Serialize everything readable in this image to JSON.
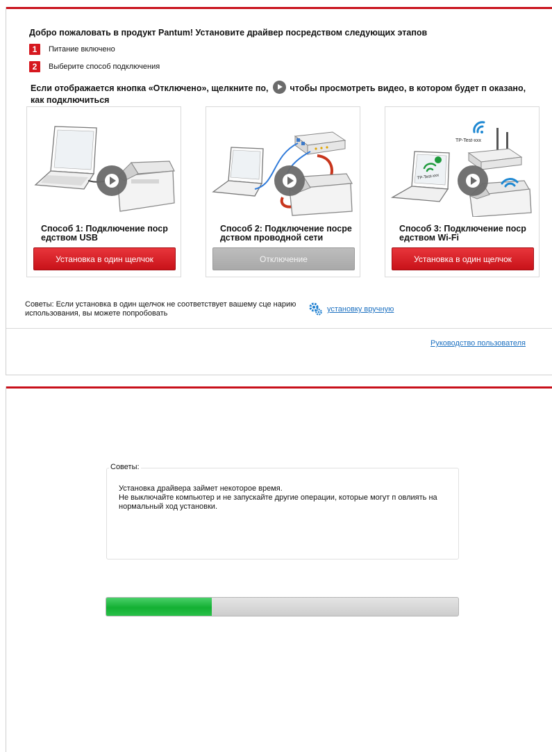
{
  "installer": {
    "welcome_title": "Добро пожаловать в продукт Pantum! Установите драйвер посредством следующих этапов",
    "steps": [
      {
        "number": "1",
        "label": "Питание включено"
      },
      {
        "number": "2",
        "label": "Выберите способ подключения"
      }
    ],
    "instruction_before": "Если отображается кнопка «Отключено», щелкните по,",
    "instruction_after": "чтобы просмотреть видео, в котором будет п оказано, как подключиться",
    "methods": [
      {
        "caption": "Способ 1: Подключение поср едством USB",
        "button": "Установка в один щелчок",
        "enabled": true
      },
      {
        "caption": "Способ 2: Подключение посре дством проводной сети",
        "button": "Отключение",
        "enabled": false
      },
      {
        "caption": "Способ 3: Подключение поср едством Wi-Fi",
        "button": "Установка в один щелчок",
        "enabled": true
      }
    ],
    "illustration_labels": {
      "router_ssid": "TP-Test-xxx",
      "laptop_ssid": "TP-Test-xxx"
    },
    "tips_text": "Советы: Если установка в один щелчок не соответствует вашему сце нарию использования, вы можете попробовать",
    "manual_install_link": "установку вручную",
    "user_guide_link": "Руководство пользователя"
  },
  "progress_screen": {
    "tips_legend": "Советы:",
    "tips_line1": "Установка драйвера займет некоторое время.",
    "tips_line2": "Не выключайте компьютер и не запускайте другие операции, которые могут п овлиять на нормальный ход установки.",
    "progress_fraction": 0.3
  },
  "colors": {
    "brand_red": "#c8101a",
    "button_red": "#d6181f",
    "disabled_gray": "#aaaaaa",
    "progress_green": "#13b033",
    "link_blue": "#1a6fc0"
  }
}
